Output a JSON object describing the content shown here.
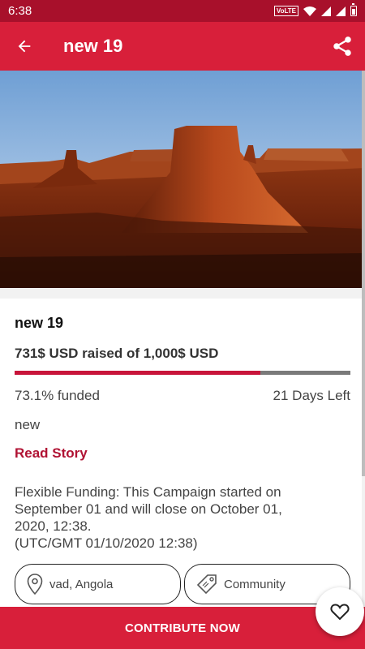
{
  "status_bar": {
    "time": "6:38",
    "network_label": "VoLTE"
  },
  "app_bar": {
    "title": "new 19",
    "back_icon": "arrow-left-icon",
    "share_icon": "share-icon"
  },
  "hero": {
    "description": "desert-mesa-landscape"
  },
  "campaign": {
    "title": "new 19",
    "raised_text": "731$ USD raised of 1,000$ USD",
    "progress_fraction": 0.731,
    "funded_text": "73.1% funded",
    "days_left_text": "21 Days Left",
    "description": "new",
    "read_story_label": "Read Story",
    "funding_info": {
      "line1": "Flexible Funding: This Campaign started on",
      "line2": "September 01 and will close on October 01,",
      "line3": "2020, 12:38.",
      "line4": "(UTC/GMT 01/10/2020 12:38)"
    },
    "location": "vad, Angola",
    "category": "Community"
  },
  "cta": {
    "label": "CONTRIBUTE NOW"
  },
  "fab": {
    "icon": "heart-icon"
  },
  "colors": {
    "primary": "#d81f3a",
    "status_bar": "#a8102b",
    "accent_text": "#b01233",
    "progress_fill": "#c8143a"
  }
}
